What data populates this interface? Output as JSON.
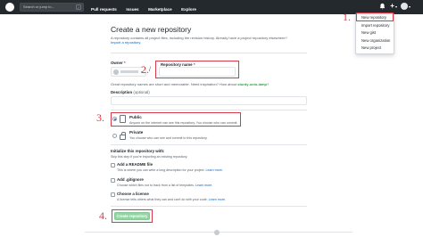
{
  "header": {
    "search_placeholder": "Search or jump to...",
    "search_shortcut": "/",
    "nav": [
      "Pull requests",
      "Issues",
      "Marketplace",
      "Explore"
    ]
  },
  "dropdown": {
    "items": [
      "New repository",
      "Import repository",
      "New gist",
      "New organization",
      "New project"
    ]
  },
  "page": {
    "title": "Create a new repository",
    "subtitle": "A repository contains all project files, including the revision history. Already have a project repository elsewhere?",
    "import_link": "Import a repository.",
    "owner_label": "Owner",
    "repo_label": "Repository name",
    "required_mark": "*",
    "separator": "/",
    "hint_prefix": "Great repository names are short and memorable. Need inspiration? How about ",
    "hint_suggestion": "sturdy-octo-lamp",
    "hint_suffix": "?",
    "desc_label": "Description",
    "desc_optional": "(optional)",
    "public_title": "Public",
    "public_desc": "Anyone on the internet can see this repository. You choose who can commit.",
    "private_title": "Private",
    "private_desc": "You choose who can see and commit to this repository.",
    "init_title": "Initialize this repository with:",
    "init_desc": "Skip this step if you're importing an existing repository.",
    "readme_label": "Add a README file",
    "readme_desc": "This is where you can write a long description for your project.",
    "gitignore_label": "Add .gitignore",
    "gitignore_desc": "Choose which files not to track from a list of templates.",
    "license_label": "Choose a license",
    "license_desc": "A license tells others what they can and can't do with your code.",
    "learn_more": "Learn more.",
    "create_button": "Create repository"
  },
  "annotations": [
    "1.",
    "2.",
    "3.",
    "4."
  ],
  "colors": {
    "header_bg": "#24292e",
    "annotation_red": "#d73a49",
    "create_green": "#94d3a2"
  }
}
